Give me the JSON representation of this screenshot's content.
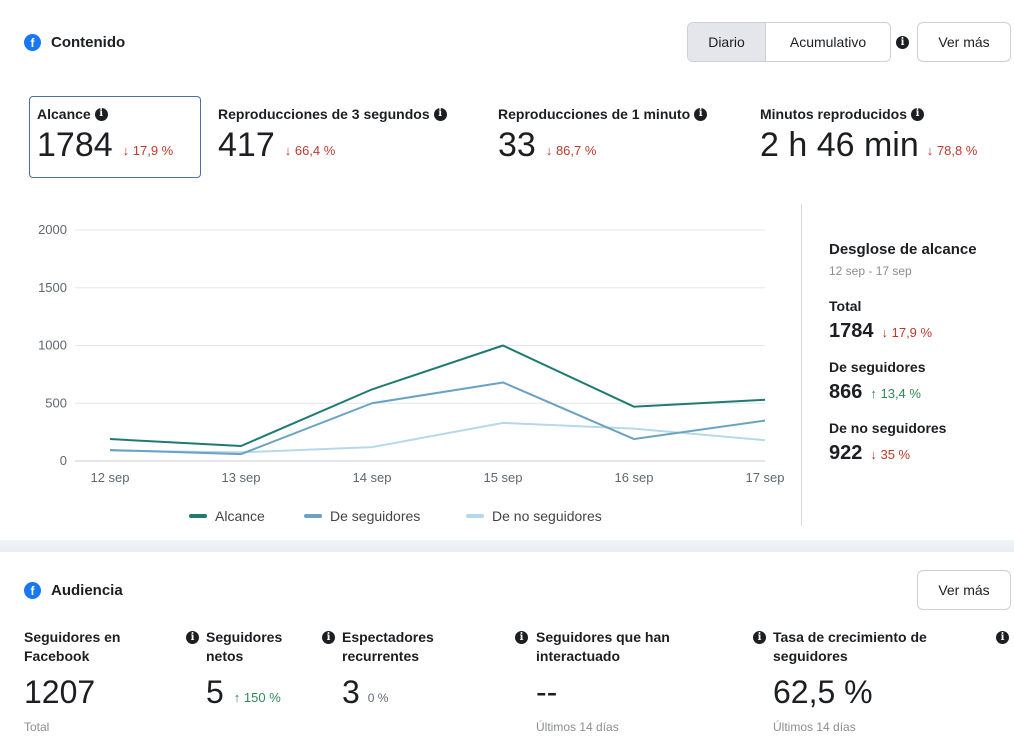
{
  "content": {
    "title": "Contenido",
    "toggle": {
      "daily": "Diario",
      "cumulative": "Acumulativo"
    },
    "see_more": "Ver más",
    "metrics": [
      {
        "label": "Alcance",
        "value": "1784",
        "delta": "↓ 17,9 %"
      },
      {
        "label": "Reproducciones de 3 segundos",
        "value": "417",
        "delta": "↓ 66,4 %"
      },
      {
        "label": "Reproducciones de 1 minuto",
        "value": "33",
        "delta": "↓ 86,7 %"
      },
      {
        "label": "Minutos reproducidos",
        "value": "2 h 46 min",
        "delta": "↓ 78,8 %"
      }
    ]
  },
  "chart_data": {
    "type": "line",
    "categories": [
      "12 sep",
      "13 sep",
      "14 sep",
      "15 sep",
      "16 sep",
      "17 sep"
    ],
    "y_ticks": [
      "0",
      "500",
      "1000",
      "1500",
      "2000"
    ],
    "ylim": [
      0,
      2000
    ],
    "grid": true,
    "legend_position": "bottom",
    "series": [
      {
        "name": "Alcance",
        "color": "#1f7a72",
        "values": [
          190,
          130,
          620,
          1000,
          470,
          530
        ]
      },
      {
        "name": "De seguidores",
        "color": "#6aa2c4",
        "values": [
          95,
          60,
          500,
          680,
          190,
          350
        ]
      },
      {
        "name": "De no seguidores",
        "color": "#b5d8eb",
        "values": [
          90,
          75,
          120,
          330,
          280,
          180
        ]
      }
    ]
  },
  "breakdown": {
    "title": "Desglose de alcance",
    "range": "12 sep - 17 sep",
    "items": [
      {
        "label": "Total",
        "value": "1784",
        "delta": "↓ 17,9 %",
        "direction": "down"
      },
      {
        "label": "De seguidores",
        "value": "866",
        "delta": "↑ 13,4 %",
        "direction": "up"
      },
      {
        "label": "De no seguidores",
        "value": "922",
        "delta": "↓ 35 %",
        "direction": "down"
      }
    ]
  },
  "audience": {
    "title": "Audiencia",
    "see_more": "Ver más",
    "metrics": [
      {
        "label_1": "Seguidores en",
        "label_2": "Facebook",
        "value": "1207",
        "delta": "",
        "foot": "Total"
      },
      {
        "label_1": "Seguidores",
        "label_2": "netos",
        "value": "5",
        "delta": "↑ 150 %",
        "foot": ""
      },
      {
        "label_1": "Espectadores",
        "label_2": "recurrentes",
        "value": "3",
        "delta": "0 %",
        "foot": ""
      },
      {
        "label_1": "Seguidores que han",
        "label_2": "interactuado",
        "value": "--",
        "delta": "",
        "foot": "Últimos 14 días"
      },
      {
        "label_1": "Tasa de crecimiento de",
        "label_2": "seguidores",
        "value": "62,5 %",
        "delta": "",
        "foot": "Últimos 14 días"
      }
    ]
  },
  "icons": {
    "brand": "facebook-icon",
    "info": "info-icon"
  },
  "colors": {
    "down": "#c0392b",
    "up": "#2f8a56",
    "brand": "#1877f2"
  }
}
